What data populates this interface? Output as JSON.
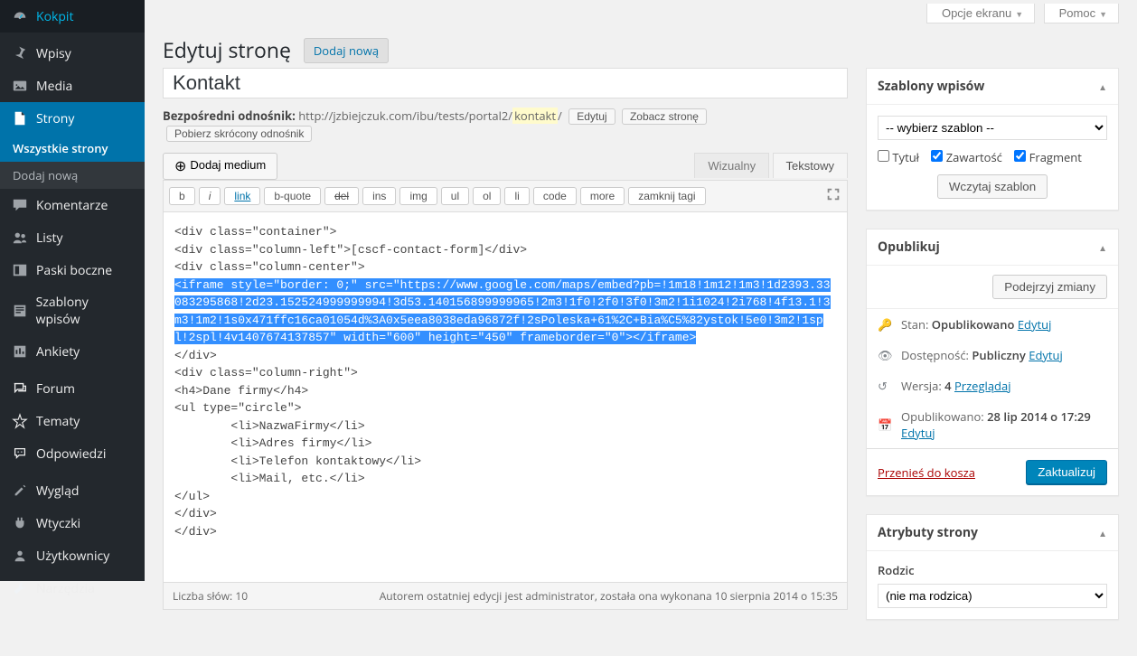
{
  "top": {
    "screen_options": "Opcje ekranu",
    "help": "Pomoc"
  },
  "sidebar": {
    "items": [
      {
        "label": "Kokpit",
        "icon": "dashboard"
      },
      {
        "sep": true
      },
      {
        "label": "Wpisy",
        "icon": "pin"
      },
      {
        "label": "Media",
        "icon": "media"
      },
      {
        "label": "Strony",
        "icon": "page",
        "current": true,
        "sub": [
          {
            "label": "Wszystkie strony",
            "current": true
          },
          {
            "label": "Dodaj nową"
          }
        ]
      },
      {
        "label": "Komentarze",
        "icon": "comment"
      },
      {
        "label": "Listy",
        "icon": "users"
      },
      {
        "label": "Paski boczne",
        "icon": "sidebar"
      },
      {
        "label": "Szablony wpisów",
        "icon": "template"
      },
      {
        "label": "Ankiety",
        "icon": "poll"
      },
      {
        "sep": true
      },
      {
        "label": "Forum",
        "icon": "forum"
      },
      {
        "label": "Tematy",
        "icon": "topics"
      },
      {
        "label": "Odpowiedzi",
        "icon": "replies"
      },
      {
        "sep": true
      },
      {
        "label": "Wygląd",
        "icon": "appearance"
      },
      {
        "label": "Wtyczki",
        "icon": "plugins"
      },
      {
        "label": "Użytkownicy",
        "icon": "user"
      },
      {
        "label": "Narzędzia",
        "icon": "tools"
      }
    ]
  },
  "header": {
    "title": "Edytuj stronę",
    "add_new": "Dodaj nową"
  },
  "title_field": {
    "value": "Kontakt"
  },
  "permalink": {
    "label": "Bezpośredni odnośnik:",
    "base": "http://jzbiejczuk.com/ibu/tests/portal2/",
    "slug": "kontakt",
    "tail": "/",
    "edit": "Edytuj",
    "view": "Zobacz stronę",
    "shortlink": "Pobierz skrócony odnośnik"
  },
  "media_button": "Dodaj medium",
  "tabs": {
    "visual": "Wizualny",
    "text": "Tekstowy"
  },
  "quicktags": [
    "b",
    "i",
    "link",
    "b-quote",
    "del",
    "ins",
    "img",
    "ul",
    "ol",
    "li",
    "code",
    "more",
    "zamknij tagi"
  ],
  "content": {
    "pre": "<div class=\"container\">\n<div class=\"column-left\">[cscf-contact-form]</div>\n<div class=\"column-center\">\n",
    "selected": "<iframe style=\"border: 0;\" src=\"https://www.google.com/maps/embed?pb=!1m18!1m12!1m3!1d2393.33083295868!2d23.152524999999994!3d53.140156899999965!2m3!1f0!2f0!3f0!3m2!1i1024!2i768!4f13.1!3m3!1m2!1s0x471ffc16ca01054d%3A0x5eea8038eda96872f!2sPoleska+61%2C+Bia%C5%82ystok!5e0!3m2!1spl!2spl!4v1407674137857\" width=\"600\" height=\"450\" frameborder=\"0\"></iframe>",
    "post": "\n</div>\n<div class=\"column-right\">\n<h4>Dane firmy</h4>\n<ul type=\"circle\">\n\t<li>NazwaFirmy</li>\n\t<li>Adres firmy</li>\n\t<li>Telefon kontaktowy</li>\n\t<li>Mail, etc.</li>\n</ul>\n</div>\n</div>"
  },
  "status_bar": {
    "word_count_label": "Liczba słów: ",
    "word_count": "10",
    "last_edit": "Autorem ostatniej edycji jest administrator, została ona wykonana 10 sierpnia 2014 o 15:35"
  },
  "box_templates": {
    "title": "Szablony wpisów",
    "select_placeholder": "-- wybierz szablon --",
    "cb_title": "Tytuł",
    "cb_content": "Zawartość",
    "cb_excerpt": "Fragment",
    "load": "Wczytaj szablon"
  },
  "box_publish": {
    "title": "Opublikuj",
    "preview": "Podejrzyj zmiany",
    "status_label": "Stan:",
    "status_value": "Opublikowano",
    "edit": "Edytuj",
    "visibility_label": "Dostępność:",
    "visibility_value": "Publiczny",
    "revisions_label": "Wersja:",
    "revisions_value": "4",
    "browse": "Przeglądaj",
    "published_label": "Opublikowano:",
    "published_value": "28 lip 2014 o 17:29",
    "trash": "Przenieś do kosza",
    "update": "Zaktualizuj"
  },
  "box_attrs": {
    "title": "Atrybuty strony",
    "parent_label": "Rodzic",
    "parent_value": "(nie ma rodzica)"
  }
}
